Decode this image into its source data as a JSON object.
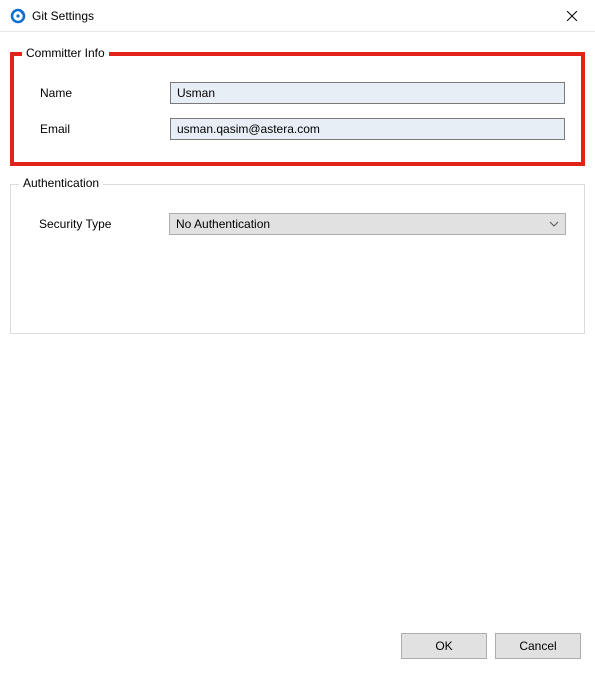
{
  "window": {
    "title": "Git Settings"
  },
  "committer": {
    "legend": "Committer Info",
    "name_label": "Name",
    "name_value": "Usman",
    "email_label": "Email",
    "email_value": "usman.qasim@astera.com"
  },
  "auth": {
    "legend": "Authentication",
    "security_type_label": "Security Type",
    "security_type_value": "No Authentication"
  },
  "buttons": {
    "ok": "OK",
    "cancel": "Cancel"
  }
}
